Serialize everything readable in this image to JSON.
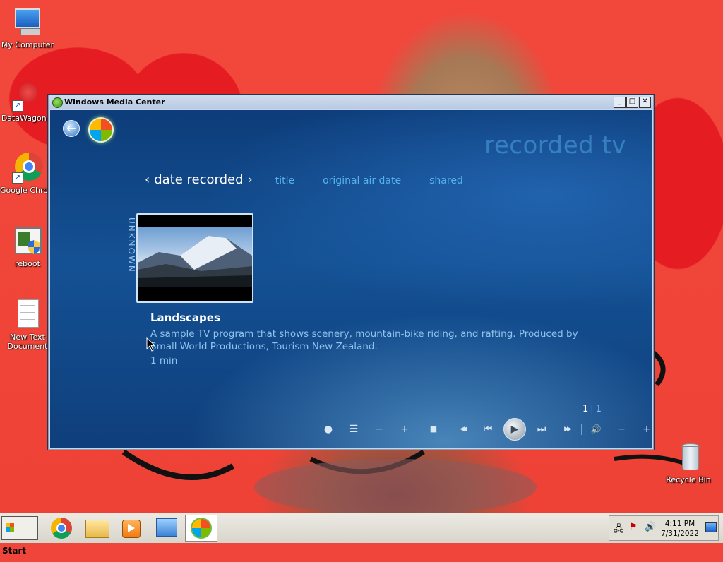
{
  "desktop": {
    "icons": [
      {
        "label": "My Computer"
      },
      {
        "label": "DataWagon..."
      },
      {
        "label": "Google Chrome"
      },
      {
        "label": "reboot"
      },
      {
        "label": "New Text Document"
      },
      {
        "label": "Recycle Bin"
      }
    ]
  },
  "window": {
    "title": "Windows Media Center",
    "buttons": {
      "minimize": "_",
      "maximize": "□",
      "close": "✕"
    }
  },
  "media_center": {
    "section_title": "recorded tv",
    "sort": {
      "active": "date recorded",
      "prev_arrow": "‹",
      "next_arrow": "›",
      "options": [
        "title",
        "original air date",
        "shared"
      ]
    },
    "group_label": "UNKNOWN",
    "program": {
      "title": "Landscapes",
      "description": "A sample TV program that shows scenery, mountain-bike riding, and rafting. Produced by Small World Productions, Tourism New Zealand.",
      "duration": "1 min"
    },
    "pager": {
      "current": "1",
      "total": "1"
    },
    "transport": {
      "record": "●",
      "guide": "☰",
      "channel_down": "−",
      "channel_up": "+",
      "stop": "■",
      "rewind": "◀◀",
      "skip_back": "⏮",
      "play": "▶",
      "skip_forward": "⏭",
      "fast_forward": "▶▶",
      "mute": "🔊",
      "volume_down": "−",
      "volume_up": "+"
    }
  },
  "taskbar": {
    "start_label": "Start",
    "clock_time": "4:11 PM",
    "clock_date": "7/31/2022"
  }
}
